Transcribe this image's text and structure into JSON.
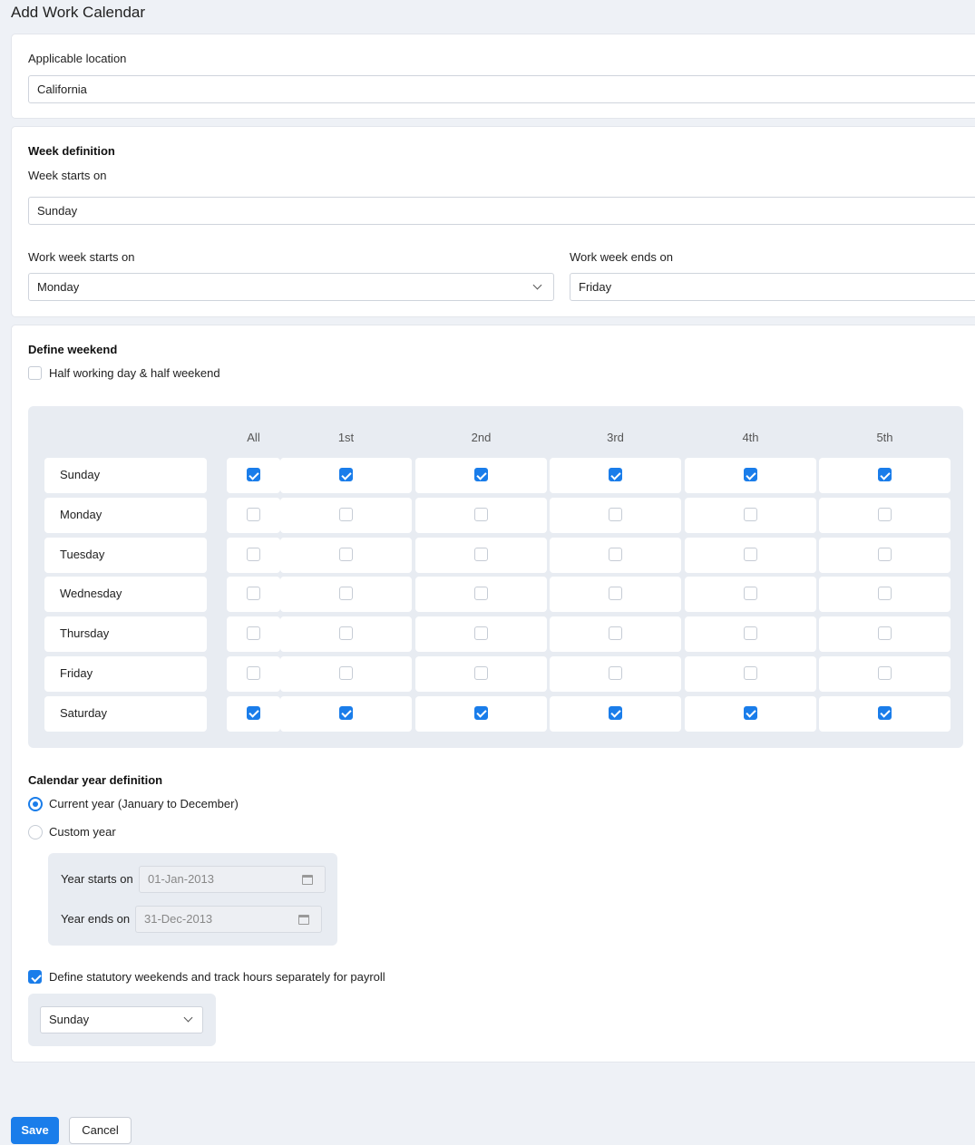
{
  "page": {
    "title": "Add Work Calendar"
  },
  "location": {
    "label": "Applicable location",
    "value": "California"
  },
  "week": {
    "section_title": "Week definition",
    "starts_label": "Week starts on",
    "starts_value": "Sunday",
    "work_start_label": "Work week starts on",
    "work_start_value": "Monday",
    "work_end_label": "Work week ends on",
    "work_end_value": "Friday"
  },
  "weekend": {
    "section_title": "Define weekend",
    "half_day_label": "Half working day & half weekend",
    "half_day_checked": false,
    "columns": [
      "All",
      "1st",
      "2nd",
      "3rd",
      "4th",
      "5th"
    ],
    "rows": [
      {
        "day": "Sunday",
        "checked": [
          true,
          true,
          true,
          true,
          true,
          true
        ]
      },
      {
        "day": "Monday",
        "checked": [
          false,
          false,
          false,
          false,
          false,
          false
        ]
      },
      {
        "day": "Tuesday",
        "checked": [
          false,
          false,
          false,
          false,
          false,
          false
        ]
      },
      {
        "day": "Wednesday",
        "checked": [
          false,
          false,
          false,
          false,
          false,
          false
        ]
      },
      {
        "day": "Thursday",
        "checked": [
          false,
          false,
          false,
          false,
          false,
          false
        ]
      },
      {
        "day": "Friday",
        "checked": [
          false,
          false,
          false,
          false,
          false,
          false
        ]
      },
      {
        "day": "Saturday",
        "checked": [
          true,
          true,
          true,
          true,
          true,
          true
        ]
      }
    ]
  },
  "calendar_year": {
    "section_title": "Calendar year definition",
    "option_current": "Current year (January to December)",
    "option_custom": "Custom year",
    "selected": "current",
    "year_starts_label": "Year starts on",
    "year_starts_value": "01-Jan-2013",
    "year_ends_label": "Year ends on",
    "year_ends_value": "31-Dec-2013"
  },
  "statutory": {
    "label": "Define statutory weekends and track hours separately for payroll",
    "checked": true,
    "value": "Sunday"
  },
  "actions": {
    "save": "Save",
    "cancel": "Cancel"
  },
  "colors": {
    "accent": "#1a7dea",
    "background": "#eef1f6"
  }
}
